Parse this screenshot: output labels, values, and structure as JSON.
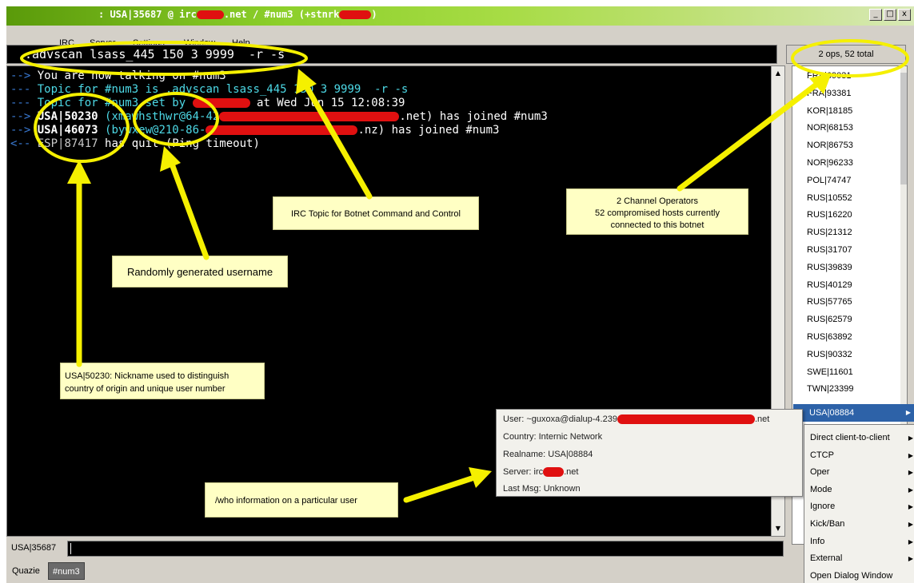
{
  "window": {
    "title_prefix": ": USA|35687 @ irc",
    "title_mid": ".net / #num3 (+stnrk",
    "btn_min": "_",
    "btn_max": "□",
    "btn_close": "x"
  },
  "menu": {
    "items": [
      "IRC",
      "Server",
      "Settings",
      "Window",
      "Help"
    ]
  },
  "command": {
    "text": ".advscan lsass_445 150 3 9999  -r -s"
  },
  "ops_box": {
    "text": "2 ops, 52 total"
  },
  "chat": {
    "lines": [
      {
        "arrow": "-->",
        "parts": [
          {
            "t": " You are now talking on #num3",
            "c": "white"
          }
        ]
      },
      {
        "arrow": "---",
        "parts": [
          {
            "t": " Topic for #num3 is .advscan lsass_445 150 3 9999  -r -s",
            "c": "cyan"
          }
        ]
      },
      {
        "arrow": "---",
        "parts": [
          {
            "t": " Topic for #num3 set by ",
            "c": "cyan"
          },
          {
            "t": "",
            "c": "redact",
            "w": 72
          },
          {
            "t": " at Wed Jun 15 12:08:39",
            "c": "white"
          }
        ]
      },
      {
        "arrow": "-->",
        "parts": [
          {
            "t": " USA|50230",
            "c": "nick"
          },
          {
            "t": " (xmawhsthwr@64-42",
            "c": "cyan"
          },
          {
            "t": "",
            "c": "redact",
            "w": 225
          },
          {
            "t": ".net) has joined #num3",
            "c": "white"
          }
        ]
      },
      {
        "arrow": "-->",
        "parts": [
          {
            "t": " USA|46073",
            "c": "nick"
          },
          {
            "t": " (bywxew@210-86-",
            "c": "cyan"
          },
          {
            "t": "",
            "c": "redact",
            "w": 190
          },
          {
            "t": ".nz) has joined #num3",
            "c": "white"
          }
        ]
      },
      {
        "arrow": "<--",
        "parts": [
          {
            "t": " ESP|87417",
            "c": "grey"
          },
          {
            "t": " has quit (Ping timeout)",
            "c": "white"
          }
        ]
      }
    ]
  },
  "nicklist": {
    "items": [
      "FRA|69031",
      "FRA|93381",
      "KOR|18185",
      "NOR|68153",
      "NOR|86753",
      "NOR|96233",
      "POL|74747",
      "RUS|10552",
      "RUS|16220",
      "RUS|21312",
      "RUS|31707",
      "RUS|39839",
      "RUS|40129",
      "RUS|57765",
      "RUS|62579",
      "RUS|63892",
      "RUS|90332",
      "SWE|11601",
      "TWN|23399"
    ],
    "selected": "USA|08884"
  },
  "whois": {
    "user_prefix": "User: ~guxoxa@dialup-4.239",
    "user_suffix": ".net",
    "country": "Country: Internic Network",
    "realname": "Realname: USA|08884",
    "server_prefix": "Server: irc",
    "server_suffix": ".net",
    "last_msg": "Last Msg: Unknown"
  },
  "context_menu": {
    "items": [
      "Direct client-to-client",
      "CTCP",
      "Oper",
      "Mode",
      "Ignore",
      "Kick/Ban",
      "Info",
      "External",
      "Open Dialog Window"
    ]
  },
  "input": {
    "nick": "USA|35687"
  },
  "tabs": {
    "items": [
      "Quazie",
      "#num3"
    ]
  },
  "callouts": {
    "topic": "IRC Topic for Botnet Command and Control",
    "ops_line1": "2 Channel Operators",
    "ops_line2": "52 compromised hosts currently",
    "ops_line3": "connected to this botnet",
    "username": "Randomly generated username",
    "nick_line1": "USA|50230: Nickname used to distinguish",
    "nick_line2": "country of origin and unique user number",
    "whois": "/who information on a particular user"
  },
  "colors": {
    "annotation_yellow": "#f5f000",
    "redaction_red": "#e01010",
    "chat_cyan": "#4dd9e6",
    "chat_arrow": "#3a7bd5"
  }
}
